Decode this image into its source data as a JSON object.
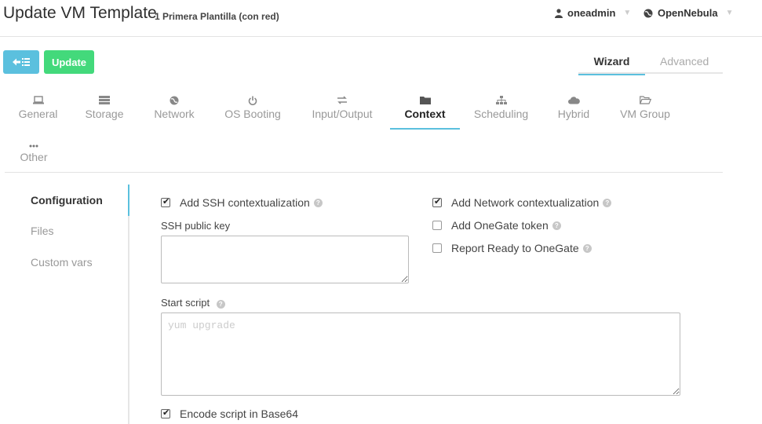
{
  "header": {
    "title": "Update VM Template",
    "subtitle": "1 Primera Plantilla (con red)",
    "user": "oneadmin",
    "zone": "OpenNebula"
  },
  "toolbar": {
    "back_icon": "arrow-left-list-icon",
    "update_label": "Update"
  },
  "modes": {
    "wizard": "Wizard",
    "advanced": "Advanced"
  },
  "tabs": [
    {
      "label": "General",
      "icon": "laptop-icon",
      "glyph": "💻"
    },
    {
      "label": "Storage",
      "icon": "storage-icon",
      "glyph": "☰"
    },
    {
      "label": "Network",
      "icon": "globe-icon",
      "glyph": "●"
    },
    {
      "label": "OS Booting",
      "icon": "power-icon",
      "glyph": "⏻"
    },
    {
      "label": "Input/Output",
      "icon": "exchange-icon",
      "glyph": "⇄"
    },
    {
      "label": "Context",
      "icon": "folder-icon",
      "glyph": "■"
    },
    {
      "label": "Scheduling",
      "icon": "sitemap-icon",
      "glyph": "⋔"
    },
    {
      "label": "Hybrid",
      "icon": "cloud-icon",
      "glyph": "☁"
    },
    {
      "label": "VM Group",
      "icon": "folder-open-icon",
      "glyph": "▭"
    },
    {
      "label": "Other",
      "icon": "ellipsis-icon",
      "glyph": "•••"
    }
  ],
  "active_tab": "Context",
  "side_menu": {
    "configuration": "Configuration",
    "files": "Files",
    "custom_vars": "Custom vars"
  },
  "context": {
    "ssh_contextualization": {
      "label": "Add SSH contextualization",
      "checked": true
    },
    "ssh_public_key_label": "SSH public key",
    "ssh_public_key_value": "",
    "network_contextualization": {
      "label": "Add Network contextualization",
      "checked": true
    },
    "onegate_token": {
      "label": "Add OneGate token",
      "checked": false
    },
    "report_ready": {
      "label": "Report Ready to OneGate",
      "checked": false
    },
    "start_script_label": "Start script",
    "start_script_placeholder": "yum upgrade",
    "encode_base64": {
      "label": "Encode script in Base64",
      "checked": true
    }
  },
  "help_glyph": "?"
}
